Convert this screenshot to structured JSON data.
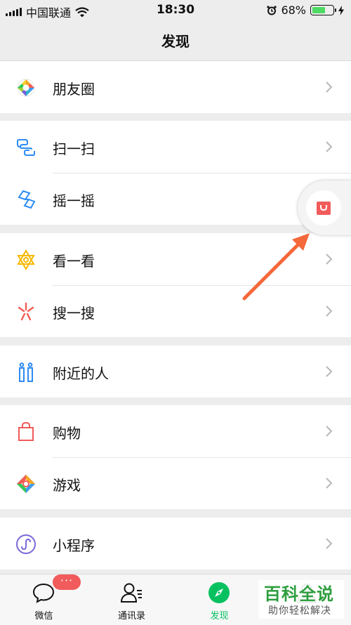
{
  "status_bar": {
    "carrier": "中国联通",
    "time": "18:30",
    "battery": "68%",
    "battery_level": 0.68
  },
  "header": {
    "title": "发现"
  },
  "groups": [
    {
      "items": [
        {
          "label": "朋友圈",
          "icon": "moments-icon"
        }
      ]
    },
    {
      "items": [
        {
          "label": "扫一扫",
          "icon": "scan-icon"
        },
        {
          "label": "摇一摇",
          "icon": "shake-icon"
        }
      ]
    },
    {
      "items": [
        {
          "label": "看一看",
          "icon": "top-stories-icon"
        },
        {
          "label": "搜一搜",
          "icon": "search-icon"
        }
      ]
    },
    {
      "items": [
        {
          "label": "附近的人",
          "icon": "people-nearby-icon"
        }
      ]
    },
    {
      "items": [
        {
          "label": "购物",
          "icon": "shopping-bag-icon"
        },
        {
          "label": "游戏",
          "icon": "games-icon"
        }
      ]
    },
    {
      "items": [
        {
          "label": "小程序",
          "icon": "mini-program-icon"
        }
      ]
    }
  ],
  "tabbar": {
    "items": [
      {
        "label": "微信",
        "badge": "···"
      },
      {
        "label": "通讯录"
      },
      {
        "label": "发现",
        "active": true
      }
    ]
  },
  "watermark": {
    "title": "百科全说",
    "subtitle": "助你轻松解决"
  },
  "colors": {
    "accent": "#07C160",
    "badge": "#F15B5B",
    "arrow": "#F4683A",
    "shopping": "#F15B5B"
  }
}
